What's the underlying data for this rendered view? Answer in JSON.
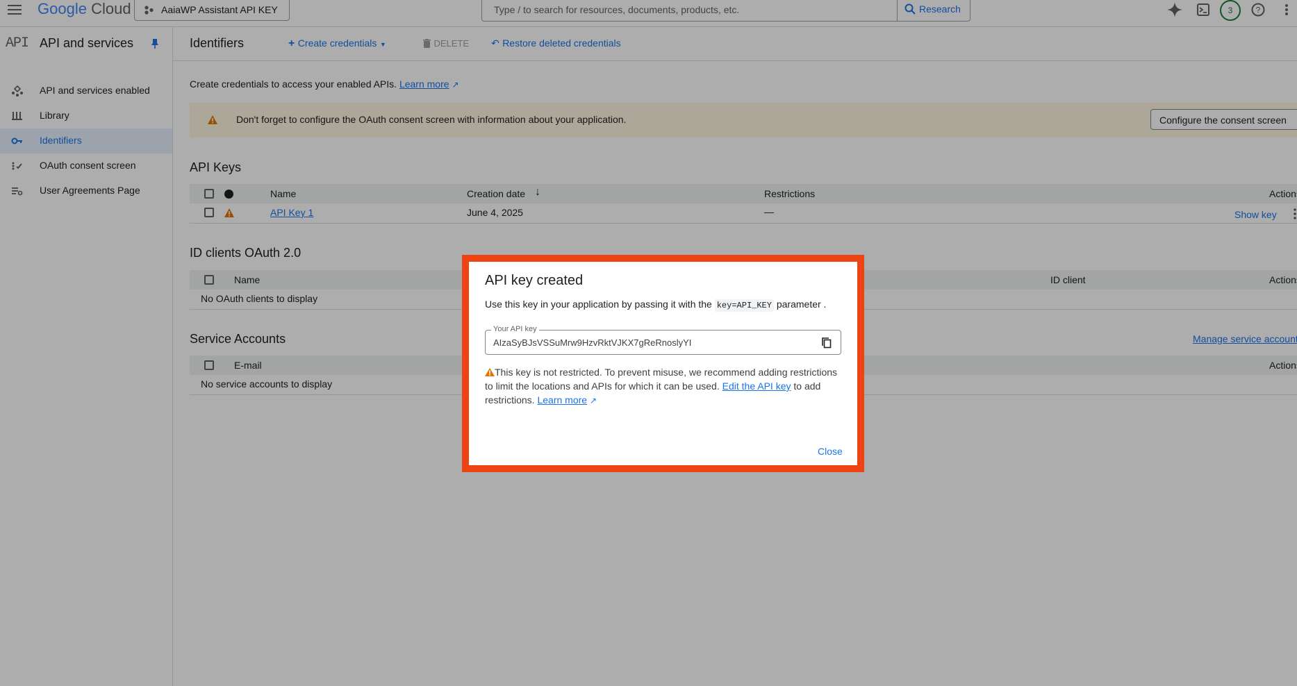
{
  "topbar": {
    "brand": {
      "google": "Google",
      "cloud": "Cloud"
    },
    "project_name": "AaiaWP Assistant API KEY",
    "search_placeholder": "Type / to search for resources, documents, products, etc.",
    "research_label": "Research",
    "notification_count": "3"
  },
  "sidebar": {
    "logo_text": "API",
    "title": "API and services",
    "items": [
      {
        "label": "API and services enabled",
        "icon": "api-icon"
      },
      {
        "label": "Library",
        "icon": "library-icon"
      },
      {
        "label": "Identifiers",
        "icon": "key-icon",
        "active": true
      },
      {
        "label": "OAuth consent screen",
        "icon": "consent-icon"
      },
      {
        "label": "User Agreements Page",
        "icon": "settings-list-icon"
      }
    ]
  },
  "toolbar": {
    "title": "Identifiers",
    "create_label": "Create credentials",
    "delete_label": "DELETE",
    "restore_label": "Restore deleted credentials"
  },
  "intro": {
    "text": "Create credentials to access your enabled APIs.",
    "learn_more": "Learn more"
  },
  "banner": {
    "text": "Don't forget to configure the OAuth consent screen with information about your application.",
    "button": "Configure the consent screen"
  },
  "api_keys": {
    "title": "API Keys",
    "columns": [
      "Name",
      "Creation date",
      "Restrictions",
      "Actions"
    ],
    "rows": [
      {
        "name": "API Key 1",
        "date": "June 4, 2025",
        "restrictions": "—",
        "action": "Show key"
      }
    ]
  },
  "oauth": {
    "title": "ID clients OAuth 2.0",
    "columns": [
      "Name",
      "ID client",
      "Actions"
    ],
    "empty": "No OAuth clients to display"
  },
  "service_accounts": {
    "title": "Service Accounts",
    "manage_link": "Manage service accounts",
    "columns": [
      "E-mail",
      "Actions"
    ],
    "empty": "No service accounts to display"
  },
  "dialog": {
    "title": "API key created",
    "desc_before": "Use this key in your application by passing it with the",
    "desc_code": "key=API_KEY",
    "desc_after": "parameter .",
    "field_label": "Your API key",
    "api_key": "AIzaSyBJsVSSuMrw9HzvRktVJKX7gReRnoslyYI",
    "warning_text": "This key is not restricted. To prevent misuse, we recommend adding restrictions to limit the locations and APIs for which it can be used.",
    "edit_link": "Edit the API key",
    "warning_suffix": "to add restrictions.",
    "learn_more": "Learn more",
    "close": "Close"
  },
  "colors": {
    "accent": "#1a73e8",
    "highlight": "#ee4312",
    "warning": "#e37400",
    "banner": "#fef7e0"
  }
}
